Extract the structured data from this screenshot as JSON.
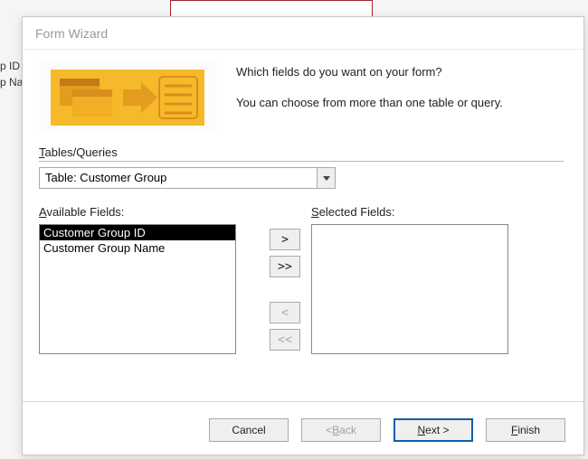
{
  "background": {
    "col1": "p ID",
    "col2": "p Name"
  },
  "dialog": {
    "title": "Form Wizard",
    "prompt1": "Which fields do you want on your form?",
    "prompt2": "You can choose from more than one table or query.",
    "tables_label_pre": "T",
    "tables_label_rest": "ables/Queries",
    "combo_value": "Table: Customer Group",
    "available_pre": "A",
    "available_rest": "vailable Fields:",
    "selected_pre": "S",
    "selected_rest": "elected Fields:",
    "available_items": [
      {
        "label": "Customer Group ID",
        "selected": true
      },
      {
        "label": "Customer Group Name",
        "selected": false
      }
    ],
    "buttons": {
      "move_one": ">",
      "move_all": ">>",
      "back_one": "<",
      "back_all": "<<",
      "cancel": "Cancel",
      "back_lt": "< ",
      "back_u": "B",
      "back_rest": "ack",
      "next_u": "N",
      "next_rest": "ext >",
      "finish_u": "F",
      "finish_rest": "inish"
    }
  }
}
